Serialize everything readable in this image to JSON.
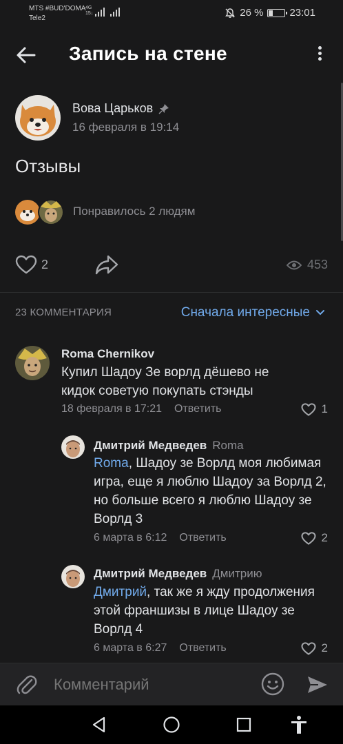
{
  "status_bar": {
    "carrier_line1": "MTS #BUD'DOMA",
    "carrier_line2": "Tele2",
    "network_top": "4G",
    "network_bottom": "15↓",
    "battery": "26 %",
    "time": "23:01"
  },
  "header": {
    "title": "Запись на стене"
  },
  "post": {
    "author": "Вова Царьков",
    "date": "16 февраля в 19:14",
    "text": "Отзывы",
    "likes_summary": "Понравилось 2 людям",
    "like_count": "2",
    "views": "453"
  },
  "comments_header": {
    "count": "23 КОММЕНТАРИЯ",
    "sort": "Сначала интересные"
  },
  "comments": [
    {
      "author": "Roma Chernikov",
      "reply_to": "",
      "mention": "",
      "text": "Купил Шадоу Зе ворлд дёшево не кидок советую покупать стэнды",
      "date": "18 февраля в 17:21",
      "reply_label": "Ответить",
      "likes": "1"
    },
    {
      "author": "Дмитрий Медведев",
      "reply_to": "Roma",
      "mention": "Roma",
      "text": ", Шадоу зе Ворлд моя любимая игра, еще я люблю Шадоу за Ворлд 2, но больше всего я люблю Шадоу зе Ворлд 3",
      "date": "6 марта в 6:12",
      "reply_label": "Ответить",
      "likes": "2"
    },
    {
      "author": "Дмитрий Медведев",
      "reply_to": "Дмитрию",
      "mention": "Дмитрий",
      "text": ", так же я жду продолжения этой франшизы в лице Шадоу зе Ворлд 4",
      "date": "6 марта в 6:27",
      "reply_label": "Ответить",
      "likes": "2"
    }
  ],
  "composer": {
    "placeholder": "Комментарий"
  },
  "colors": {
    "background": "#19191a",
    "accent": "#71aaeb",
    "secondary_text": "#8e8e93"
  },
  "icons": [
    "back-arrow-icon",
    "more-vertical-icon",
    "pin-icon",
    "heart-icon",
    "share-icon",
    "eye-icon",
    "chevron-down-icon",
    "attach-icon",
    "emoji-icon",
    "send-icon",
    "nav-back-icon",
    "nav-home-icon",
    "nav-recent-icon",
    "accessibility-icon"
  ]
}
